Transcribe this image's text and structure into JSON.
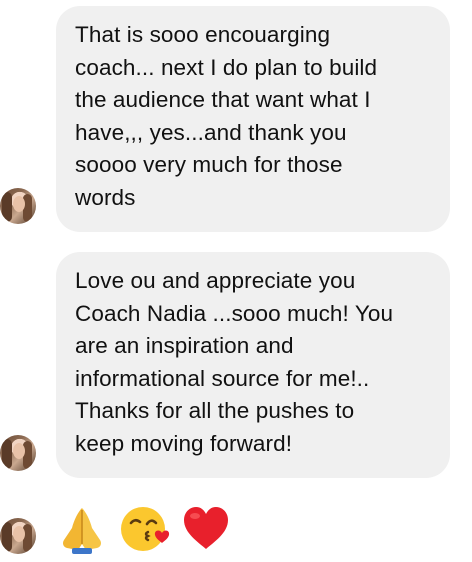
{
  "messages": [
    {
      "lines": [
        "That is sooo encouarging",
        "coach... next I do plan to build",
        "the audience that want what I",
        "have,,, yes...and thank you",
        "soooo very much for those",
        "words"
      ]
    },
    {
      "lines": [
        "Love ou and appreciate you",
        "Coach Nadia ...sooo much! You",
        "are an inspiration and",
        "informational source for me!..",
        "Thanks for all the pushes to",
        "keep moving forward!"
      ]
    }
  ],
  "reactions": {
    "icons": [
      "folded-hands-icon",
      "face-blowing-a-kiss-icon",
      "red-heart-icon"
    ]
  },
  "colors": {
    "bubble_bg": "#f0f0f0",
    "text": "#111111",
    "heart": "#e8202c",
    "hands": "#f2b632",
    "face": "#fbc72e",
    "kiss_heart": "#e8202c"
  }
}
